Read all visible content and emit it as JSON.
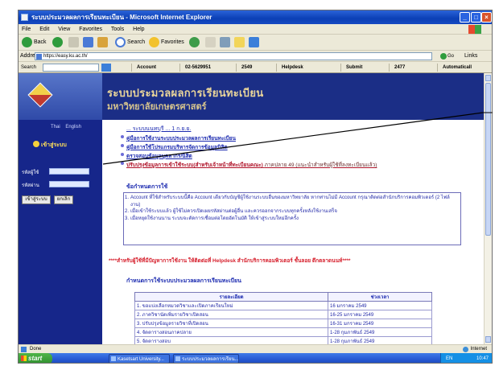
{
  "window": {
    "title": "ระบบประมวลผลการเรียนทะเบียน - Microsoft Internet Explorer",
    "minimize": "_",
    "maximize": "□",
    "close": "×"
  },
  "menu": [
    "File",
    "Edit",
    "View",
    "Favorites",
    "Tools",
    "Help"
  ],
  "toolbar": {
    "back": "Back",
    "search": "Search",
    "favorites": "Favorites"
  },
  "address": {
    "label": "Address",
    "url": "https://easy.ku.ac.th/",
    "go": "Go",
    "links": "Links"
  },
  "linksbar": {
    "search_label": "Search",
    "items": [
      "Account",
      "02-5629951",
      "2549",
      "Helpdesk",
      "Submit",
      "2477",
      "Automaticall"
    ]
  },
  "site": {
    "title": "ระบบประมวลผลการเรียนทะเบียน",
    "subtitle": "มหาวิทยาลัยเกษตรศาสตร์"
  },
  "sidebar": {
    "lang_thai": "Thai",
    "lang_english": "English",
    "login_title": "เข้าสู่ระบบ",
    "user_label": "รหัสผู้ใช้",
    "password_label": "รหัสผ่าน",
    "login_button": "เข้าสู่ระบบ",
    "cancel_button": "ยกเลิก"
  },
  "news": {
    "heading": "... ระบบนนทบุรี ... 1 ก.ย.ย.",
    "items": [
      "คู่มือการใช้งานระบบประมวลผลการเรียนทะเบียน",
      "คู่มือการใช้โปรแกรมบริหารจัดการข้อมูลนิสิต",
      "ตรวจสอบข้อมูลบุคลากร/นิสิต",
      "ปรับปรุงข้อมูลการเข้าใช้ระบบ(สำหรับเจ้าหน้าที่ทะเบียนคณะ)"
    ],
    "last_item_note": "ภาคปลาย 49 (แนะนำสำหรับผู้ใช้ที่ลงทะเบียนแล้ว)"
  },
  "notice": {
    "heading": "ข้อกำหนดการใช้",
    "items": [
      "Account ที่ใช้สำหรับระบบนี้คือ Account เดียวกับบัญชีผู้ใช้งานระบบอื่นของมหาวิทยาลัย หากท่านไม่มี Account กรุณาติดต่อสำนักบริการคอมพิวเตอร์ (2 ไฟล์งาน)",
      "เมื่อเข้าใช้ระบบแล้ว ผู้ใช้ไม่ควรเปิดเผยรหัสผ่านต่อผู้อื่น และควรออกจากระบบทุกครั้งหลังใช้งานเสร็จ",
      "เมื่อหยุดใช้งานนาน ระบบจะตัดการเชื่อมต่อโดยอัตโนมัติ ให้เข้าสู่ระบบใหม่อีกครั้ง"
    ]
  },
  "red_notice": "****สำหรับผู้ใช้ที่มีปัญหาการใช้งาน ให้ติดต่อที่ Helpdesk สำนักบริการคอมพิวเตอร์ ชั้นลอย ตึกตลาดนนท์****",
  "schedule": {
    "heading": "กำหนดการใช้ระบบประมวลผลการเรียนทะเบียน",
    "columns": [
      "รายละเอียด",
      "ช่วงเวลา"
    ],
    "rows": [
      [
        "1. ขอแบ่งเลือกหมวดวิชาและเปิดภาคเรียนใหม่",
        "16 มกราคม 2549"
      ],
      [
        "2. ภาควิชานัดเพิ่มรายวิชาเปิดสอน",
        "16-25 มกราคม 2549"
      ],
      [
        "3. ปรับปรุงข้อมูลรายวิชาที่เปิดสอน",
        "16-31 มกราคม 2549"
      ],
      [
        "4. จัดตารางสอนภาคปลาย",
        "1-28 กุมภาพันธ์ 2549"
      ],
      [
        "5. จัดตารางสอบ",
        "1-28 กุมภาพันธ์ 2549"
      ]
    ]
  },
  "status": {
    "left": "Done",
    "zone": "Internet"
  },
  "taskbar": {
    "start": "start",
    "tasks": [
      "Kasetsart University...",
      "ระบบประมวลผลการเรียน..."
    ],
    "lang": "EN",
    "clock": "10:47"
  }
}
